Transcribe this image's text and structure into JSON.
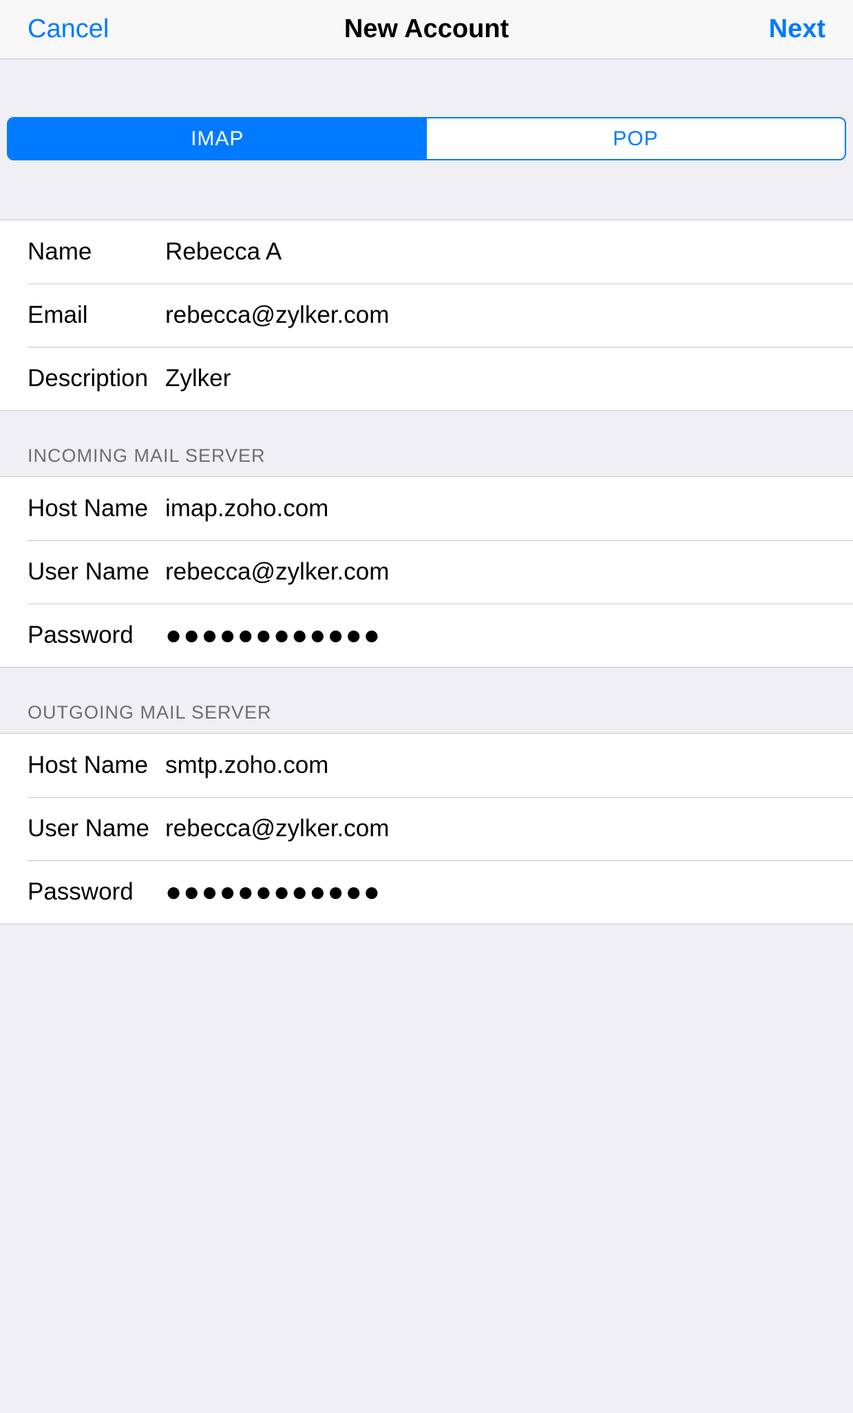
{
  "header": {
    "cancel": "Cancel",
    "title": "New Account",
    "next": "Next"
  },
  "segmented": {
    "imap": "IMAP",
    "pop": "POP"
  },
  "account": {
    "name_label": "Name",
    "name_value": "Rebecca A",
    "email_label": "Email",
    "email_value": "rebecca@zylker.com",
    "description_label": "Description",
    "description_value": "Zylker"
  },
  "incoming": {
    "section_title": "Incoming Mail Server",
    "host_label": "Host Name",
    "host_value": "imap.zoho.com",
    "user_label": "User Name",
    "user_value": "rebecca@zylker.com",
    "password_label": "Password",
    "password_value": "●●●●●●●●●●●●"
  },
  "outgoing": {
    "section_title": "Outgoing Mail Server",
    "host_label": "Host Name",
    "host_value": "smtp.zoho.com",
    "user_label": "User Name",
    "user_value": "rebecca@zylker.com",
    "password_label": "Password",
    "password_value": "●●●●●●●●●●●●"
  }
}
